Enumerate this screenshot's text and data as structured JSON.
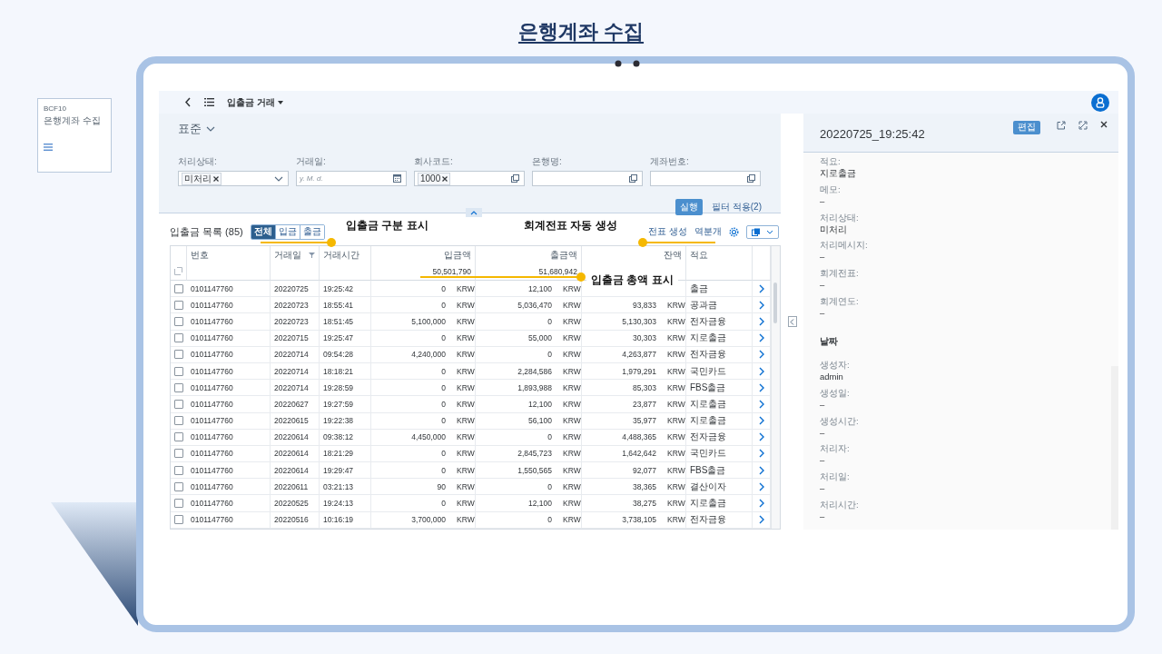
{
  "slide_title": "은행계좌 수집",
  "tile": {
    "code": "BCF10",
    "title": "은행계좌 수집"
  },
  "app": {
    "top_bar": {
      "title": "입출금 거래"
    },
    "filter_bar": {
      "variant": "표준",
      "fields": [
        {
          "label": "처리상태:",
          "kind": "dropdown",
          "token": "미처리"
        },
        {
          "label": "거래일:",
          "kind": "date",
          "placeholder": "y. M. d."
        },
        {
          "label": "회사코드:",
          "kind": "valuehelp",
          "token": "1000"
        },
        {
          "label": "은행명:",
          "kind": "valuehelp"
        },
        {
          "label": "계좌번호:",
          "kind": "valuehelp"
        }
      ],
      "go_button": "실행",
      "adapt_button": "필터 적용(2)"
    },
    "table": {
      "title": "입출금 목록 (85)",
      "segments": [
        {
          "label": "전체",
          "selected": true
        },
        {
          "label": "입금",
          "selected": false
        },
        {
          "label": "출금",
          "selected": false
        }
      ],
      "actions": [
        "전표 생성",
        "역분개"
      ],
      "columns": [
        {
          "label": "번호",
          "kind": "text"
        },
        {
          "label": "거래일",
          "kind": "text"
        },
        {
          "label": "거래시간",
          "kind": "text"
        },
        {
          "label": "입금액",
          "kind": "amount"
        },
        {
          "label": "출금액",
          "kind": "amount"
        },
        {
          "label": "잔액",
          "kind": "amount"
        },
        {
          "label": "적요",
          "kind": "text"
        }
      ],
      "totals": {
        "deposit": "50,501,790",
        "withdrawal": "51,680,942"
      },
      "rows": [
        {
          "checked": false,
          "account": "0101147760",
          "date": "20220725",
          "time": "19:25:42",
          "deposit": "0",
          "deposit_cur": "KRW",
          "withdrawal": "12,100",
          "withdrawal_cur": "KRW",
          "memo": "출금"
        },
        {
          "checked": false,
          "account": "0101147760",
          "date": "20220723",
          "time": "18:55:41",
          "deposit": "0",
          "deposit_cur": "KRW",
          "withdrawal": "5,036,470",
          "withdrawal_cur": "KRW",
          "balance": "93,833",
          "balance_cur": "KRW",
          "memo": "공과금"
        },
        {
          "checked": false,
          "account": "0101147760",
          "date": "20220723",
          "time": "18:51:45",
          "deposit": "5,100,000",
          "deposit_cur": "KRW",
          "withdrawal": "0",
          "withdrawal_cur": "KRW",
          "balance": "5,130,303",
          "balance_cur": "KRW",
          "memo": "전자금융"
        },
        {
          "checked": false,
          "account": "0101147760",
          "date": "20220715",
          "time": "19:25:47",
          "deposit": "0",
          "deposit_cur": "KRW",
          "withdrawal": "55,000",
          "withdrawal_cur": "KRW",
          "balance": "30,303",
          "balance_cur": "KRW",
          "memo": "지로출금"
        },
        {
          "checked": false,
          "account": "0101147760",
          "date": "20220714",
          "time": "09:54:28",
          "deposit": "4,240,000",
          "deposit_cur": "KRW",
          "withdrawal": "0",
          "withdrawal_cur": "KRW",
          "balance": "4,263,877",
          "balance_cur": "KRW",
          "memo": "전자금융"
        },
        {
          "checked": false,
          "account": "0101147760",
          "date": "20220714",
          "time": "18:18:21",
          "deposit": "0",
          "deposit_cur": "KRW",
          "withdrawal": "2,284,586",
          "withdrawal_cur": "KRW",
          "balance": "1,979,291",
          "balance_cur": "KRW",
          "memo": "국민카드"
        },
        {
          "checked": false,
          "account": "0101147760",
          "date": "20220714",
          "time": "19:28:59",
          "deposit": "0",
          "deposit_cur": "KRW",
          "withdrawal": "1,893,988",
          "withdrawal_cur": "KRW",
          "balance": "85,303",
          "balance_cur": "KRW",
          "memo": "FBS출금"
        },
        {
          "checked": false,
          "account": "0101147760",
          "date": "20220627",
          "time": "19:27:59",
          "deposit": "0",
          "deposit_cur": "KRW",
          "withdrawal": "12,100",
          "withdrawal_cur": "KRW",
          "balance": "23,877",
          "balance_cur": "KRW",
          "memo": "지로출금"
        },
        {
          "checked": false,
          "account": "0101147760",
          "date": "20220615",
          "time": "19:22:38",
          "deposit": "0",
          "deposit_cur": "KRW",
          "withdrawal": "56,100",
          "withdrawal_cur": "KRW",
          "balance": "35,977",
          "balance_cur": "KRW",
          "memo": "지로출금"
        },
        {
          "checked": false,
          "account": "0101147760",
          "date": "20220614",
          "time": "09:38:12",
          "deposit": "4,450,000",
          "deposit_cur": "KRW",
          "withdrawal": "0",
          "withdrawal_cur": "KRW",
          "balance": "4,488,365",
          "balance_cur": "KRW",
          "memo": "전자금융"
        },
        {
          "checked": false,
          "account": "0101147760",
          "date": "20220614",
          "time": "18:21:29",
          "deposit": "0",
          "deposit_cur": "KRW",
          "withdrawal": "2,845,723",
          "withdrawal_cur": "KRW",
          "balance": "1,642,642",
          "balance_cur": "KRW",
          "memo": "국민카드"
        },
        {
          "checked": false,
          "account": "0101147760",
          "date": "20220614",
          "time": "19:29:47",
          "deposit": "0",
          "deposit_cur": "KRW",
          "withdrawal": "1,550,565",
          "withdrawal_cur": "KRW",
          "balance": "92,077",
          "balance_cur": "KRW",
          "memo": "FBS출금"
        },
        {
          "checked": false,
          "account": "0101147760",
          "date": "20220611",
          "time": "03:21:13",
          "deposit": "90",
          "deposit_cur": "KRW",
          "withdrawal": "0",
          "withdrawal_cur": "KRW",
          "balance": "38,365",
          "balance_cur": "KRW",
          "memo": "결산이자"
        },
        {
          "checked": false,
          "account": "0101147760",
          "date": "20220525",
          "time": "19:24:13",
          "deposit": "0",
          "deposit_cur": "KRW",
          "withdrawal": "12,100",
          "withdrawal_cur": "KRW",
          "balance": "38,275",
          "balance_cur": "KRW",
          "memo": "지로출금"
        },
        {
          "checked": false,
          "account": "0101147760",
          "date": "20220516",
          "time": "10:16:19",
          "deposit": "3,700,000",
          "deposit_cur": "KRW",
          "withdrawal": "0",
          "withdrawal_cur": "KRW",
          "balance": "3,738,105",
          "balance_cur": "KRW",
          "memo": "전자금융"
        }
      ]
    },
    "detail": {
      "title": "20220725_19:25:42",
      "edit_button": "편집",
      "fields": [
        {
          "label": "적요:",
          "value": "지로출금"
        },
        {
          "label": "메모:",
          "value": "–"
        },
        {
          "label": "처리상태:",
          "value": "미처리"
        },
        {
          "label": "처리메시지:",
          "value": "–"
        },
        {
          "label": "회계전표:",
          "value": "–"
        },
        {
          "label": "회계연도:",
          "value": "–"
        }
      ],
      "section": "날짜",
      "section_fields": [
        {
          "label": "생성자:",
          "value": "admin"
        },
        {
          "label": "생성일:",
          "value": "–"
        },
        {
          "label": "생성시간:",
          "value": "–"
        },
        {
          "label": "처리자:",
          "value": "–"
        },
        {
          "label": "처리일:",
          "value": "–"
        },
        {
          "label": "처리시간:",
          "value": "–"
        }
      ]
    }
  },
  "callouts": [
    {
      "text": "입출금 구분 표시"
    },
    {
      "text": "회계전표 자동 생성"
    },
    {
      "text": "입출금 총액 표시"
    }
  ]
}
